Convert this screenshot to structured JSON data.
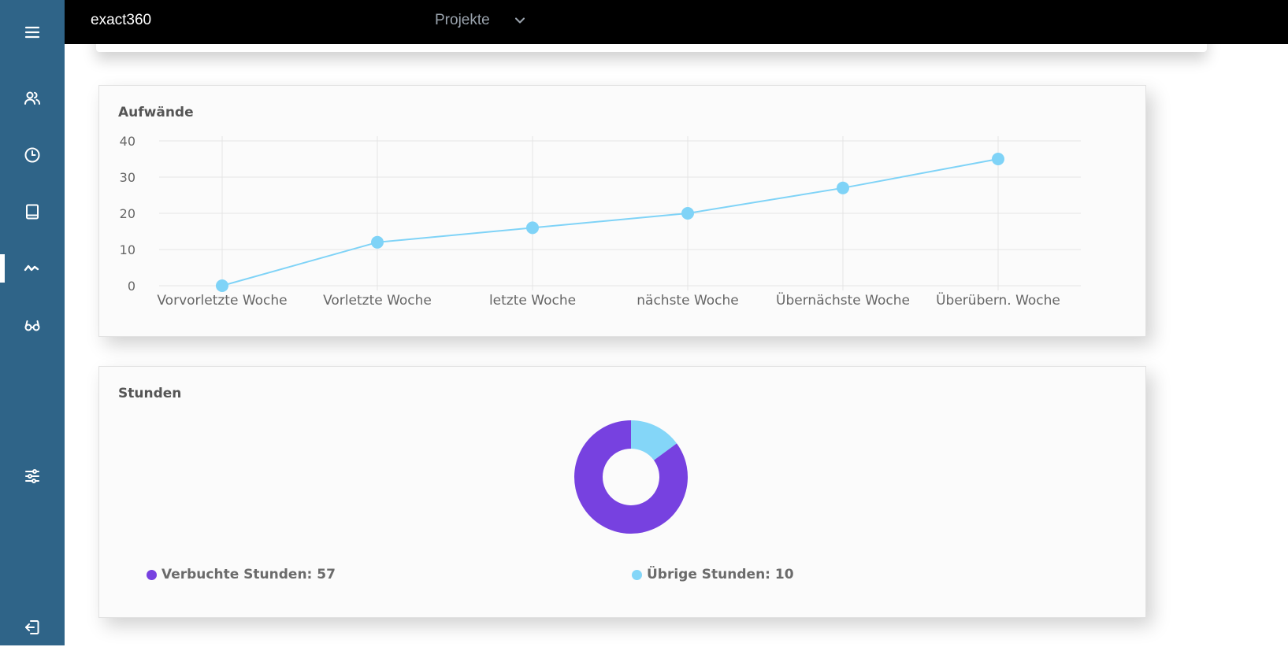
{
  "app": {
    "brand": "exact360"
  },
  "nav": {
    "dropdown_label": "Projekte",
    "items": [
      {
        "icon": "menu-icon"
      },
      {
        "icon": "users-icon"
      },
      {
        "icon": "clock-icon"
      },
      {
        "icon": "book-icon"
      },
      {
        "icon": "activity-icon",
        "active": true
      },
      {
        "icon": "glasses-icon"
      },
      {
        "icon": "sliders-icon"
      },
      {
        "icon": "logout-icon"
      }
    ]
  },
  "colors": {
    "sidebar": "#2f6488",
    "line": "#7fd3f7",
    "purple": "#7741e0",
    "light_blue": "#84d6f8"
  },
  "cards": {
    "aufwaende": {
      "title": "Aufwände"
    },
    "stunden": {
      "title": "Stunden"
    }
  },
  "legend": {
    "booked": "Verbuchte Stunden: 57",
    "remaining": "Übrige Stunden: 10"
  },
  "chart_data": [
    {
      "type": "line",
      "title": "Aufwände",
      "categories": [
        "Vorvorletzte Woche",
        "Vorletzte Woche",
        "letzte Woche",
        "nächste Woche",
        "Übernächste Woche",
        "Überübern. Woche"
      ],
      "series": [
        {
          "values": [
            0,
            12,
            16,
            20,
            27,
            35
          ]
        }
      ],
      "yticks": [
        "0",
        "10",
        "20",
        "30",
        "40"
      ],
      "ylim": [
        0,
        40
      ],
      "grid": true
    },
    {
      "type": "pie",
      "title": "Stunden",
      "labels": [
        "Verbuchte Stunden",
        "Übrige Stunden"
      ],
      "values": [
        57,
        10
      ],
      "donut": true,
      "colors": [
        "#7741e0",
        "#84d6f8"
      ]
    }
  ]
}
